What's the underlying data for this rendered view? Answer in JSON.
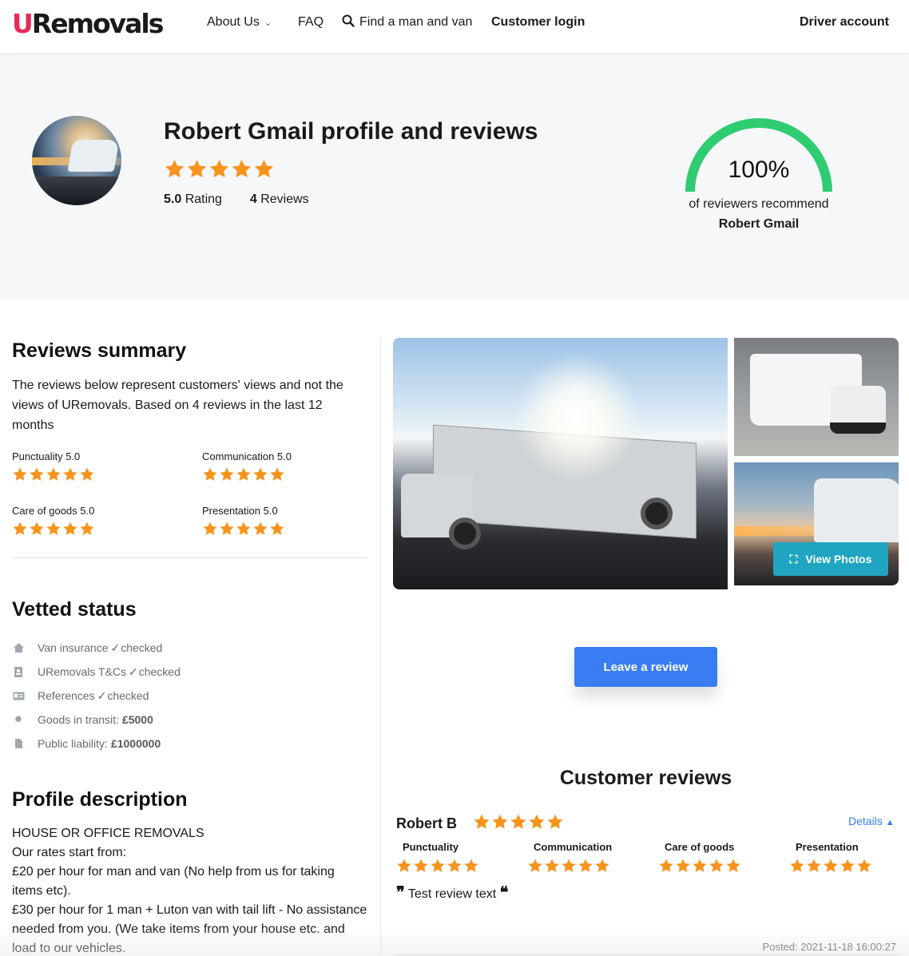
{
  "nav": {
    "logo": {
      "u": "U",
      "rest": "Removals"
    },
    "about": "About Us",
    "faq": "FAQ",
    "find": "Find a man and van",
    "login": "Customer login",
    "driver": "Driver account"
  },
  "hero": {
    "title": "Robert Gmail profile and reviews",
    "rating_value": "5.0",
    "rating_label": "Rating",
    "reviews_count": "4",
    "reviews_label": "Reviews",
    "stars": 5,
    "recommend_percent": "100%",
    "recommend_fraction": 1.0,
    "recommend_text": "of reviewers recommend",
    "recommend_name": "Robert Gmail"
  },
  "colors": {
    "accent_blue": "#3a7df2",
    "teal": "#1fa5c0",
    "star": "#f7941d",
    "gauge": "#2fcc71",
    "brand_pink": "#e8295b"
  },
  "summary": {
    "title": "Reviews summary",
    "text": "The reviews below represent customers' views and not the views of URemovals. Based on 4 reviews in the last 12 months",
    "criteria": [
      {
        "label": "Punctuality 5.0",
        "stars": 5
      },
      {
        "label": "Communication 5.0",
        "stars": 5
      },
      {
        "label": "Care of goods 5.0",
        "stars": 5
      },
      {
        "label": "Presentation 5.0",
        "stars": 5
      }
    ]
  },
  "vetted": {
    "title": "Vetted status",
    "items": [
      {
        "icon": "house-icon",
        "label": "Van insurance",
        "check": "checked"
      },
      {
        "icon": "document-person-icon",
        "label": "URemovals T&Cs",
        "check": "checked"
      },
      {
        "icon": "id-card-icon",
        "label": "References",
        "check": "checked"
      },
      {
        "icon": "gear-badge-icon",
        "label": "Goods in transit:",
        "value": "£5000"
      },
      {
        "icon": "file-icon",
        "label": "Public liability:",
        "value": "£1000000"
      }
    ]
  },
  "profile": {
    "title": "Profile description",
    "lines": [
      "HOUSE OR OFFICE REMOVALS",
      "Our rates start from:",
      "£20 per hour for man and van (No help from us for taking items etc).",
      "£30 per hour for 1 man + Luton van with tail lift - No assistance needed from you. (We take items from your house etc. and load to our vehicles."
    ]
  },
  "gallery": {
    "view_photos": "View Photos"
  },
  "leave_review": "Leave a review",
  "reviews": {
    "title": "Customer reviews",
    "items": [
      {
        "name": "Robert B",
        "stars": 5,
        "details": "Details",
        "criteria": [
          {
            "label": "Punctuality",
            "stars": 5
          },
          {
            "label": "Communication",
            "stars": 5
          },
          {
            "label": "Care of goods",
            "stars": 5
          },
          {
            "label": "Presentation",
            "stars": 5
          }
        ],
        "text": "Test review text",
        "posted": "Posted: 2021-11-18 16:00:27"
      }
    ]
  }
}
